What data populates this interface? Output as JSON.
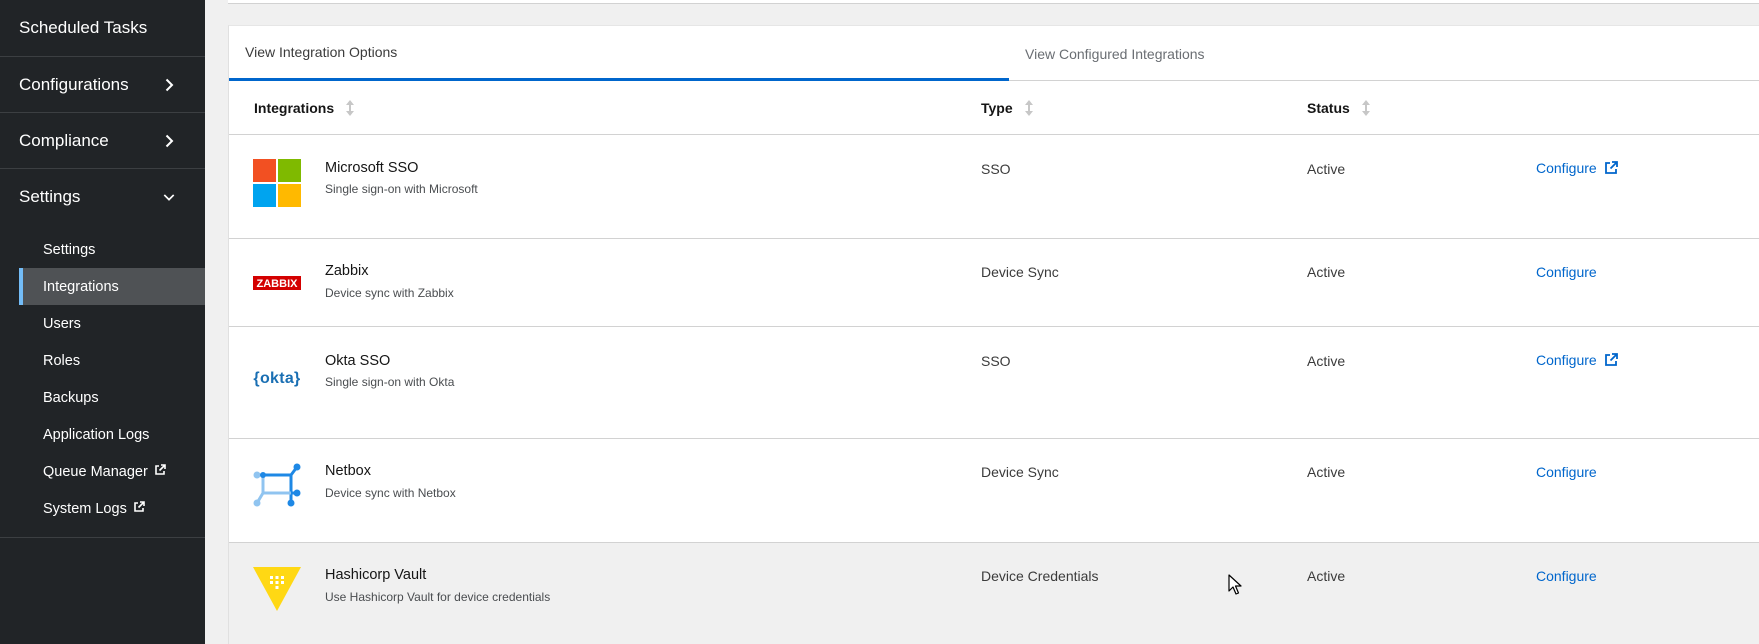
{
  "sidebar": {
    "scheduled_tasks": "Scheduled Tasks",
    "configurations": "Configurations",
    "compliance": "Compliance",
    "settings": "Settings",
    "sub_items": [
      {
        "label": "Settings"
      },
      {
        "label": "Integrations"
      },
      {
        "label": "Users"
      },
      {
        "label": "Roles"
      },
      {
        "label": "Backups"
      },
      {
        "label": "Application Logs"
      },
      {
        "label": "Queue Manager"
      },
      {
        "label": "System Logs"
      }
    ]
  },
  "tabs": {
    "options": "View Integration Options",
    "configured": "View Configured Integrations"
  },
  "table": {
    "headers": {
      "integrations": "Integrations",
      "type": "Type",
      "status": "Status"
    },
    "rows": [
      {
        "name": "Microsoft SSO",
        "desc": "Single sign-on with Microsoft",
        "type": "SSO",
        "status": "Active",
        "action": "Configure",
        "logo": "microsoft-logo"
      },
      {
        "name": "Zabbix",
        "desc": "Device sync with Zabbix",
        "type": "Device Sync",
        "status": "Active",
        "action": "Configure",
        "logo": "zabbix-logo",
        "logo_text": "ZABBIX"
      },
      {
        "name": "Okta SSO",
        "desc": "Single sign-on with Okta",
        "type": "SSO",
        "status": "Active",
        "action": "Configure",
        "logo": "okta-logo",
        "logo_text": "{okta}"
      },
      {
        "name": "Netbox",
        "desc": "Device sync with Netbox",
        "type": "Device Sync",
        "status": "Active",
        "action": "Configure",
        "logo": "netbox-logo"
      },
      {
        "name": "Hashicorp Vault",
        "desc": "Use Hashicorp Vault for device credentials",
        "type": "Device Credentials",
        "status": "Active",
        "action": "Configure",
        "logo": "hashicorp-vault-logo"
      }
    ]
  },
  "colors": {
    "sidebar_bg": "#212427",
    "link": "#0066cc",
    "active_tab": "#0066cc"
  }
}
